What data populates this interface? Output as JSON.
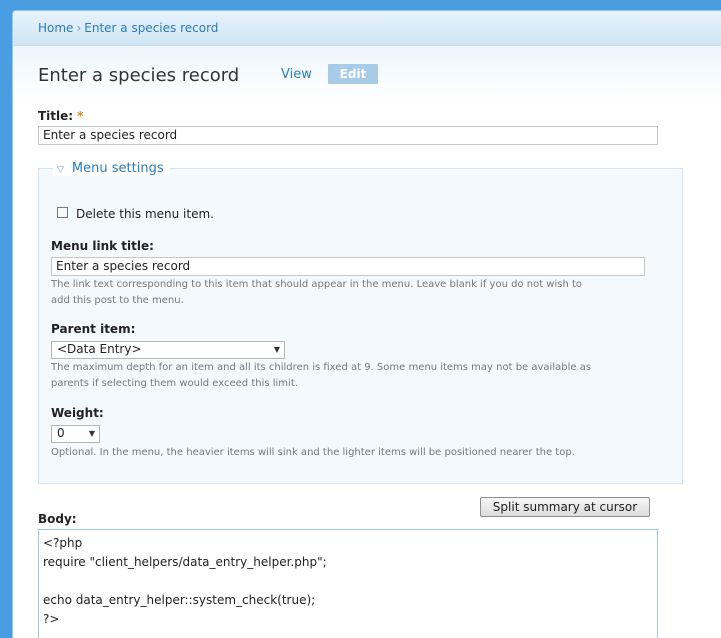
{
  "breadcrumb": {
    "home": "Home",
    "separator": "›",
    "current": "Enter a species record"
  },
  "page_title": "Enter a species record",
  "tabs": [
    {
      "label": "View",
      "active": false
    },
    {
      "label": "Edit",
      "active": true
    }
  ],
  "title_field": {
    "label": "Title:",
    "required_marker": "*",
    "value": "Enter a species record"
  },
  "menu_settings": {
    "legend": "Menu settings",
    "delete_checkbox": {
      "label": "Delete this menu item.",
      "checked": false
    },
    "menu_link_title": {
      "label": "Menu link title:",
      "value": "Enter a species record",
      "description_line1": "The link text corresponding to this item that should appear in the menu. Leave blank if you do not wish to",
      "description_line2": "add this post to the menu."
    },
    "parent_item": {
      "label": "Parent item:",
      "selected": "<Data Entry>",
      "description_line1": "The maximum depth for an item and all its children is fixed at 9. Some menu items may not be available as",
      "description_line2": "parents if selecting them would exceed this limit."
    },
    "weight": {
      "label": "Weight:",
      "selected": "0",
      "description": "Optional. In the menu, the heavier items will sink and the lighter items will be positioned nearer the top."
    }
  },
  "split_button_label": "Split summary at cursor",
  "body": {
    "label": "Body:",
    "lines": [
      "<?php",
      "require \"client_helpers/data_entry_helper.php\";",
      "",
      "echo data_entry_helper::system_check(true);",
      "?>"
    ]
  },
  "icons": {
    "collapse": "triangle-down-icon",
    "dropdown": "chevron-down-icon"
  },
  "colors": {
    "link": "#2a7bbd",
    "required": "#e0891a",
    "active_tab": "#a8cbe7"
  }
}
